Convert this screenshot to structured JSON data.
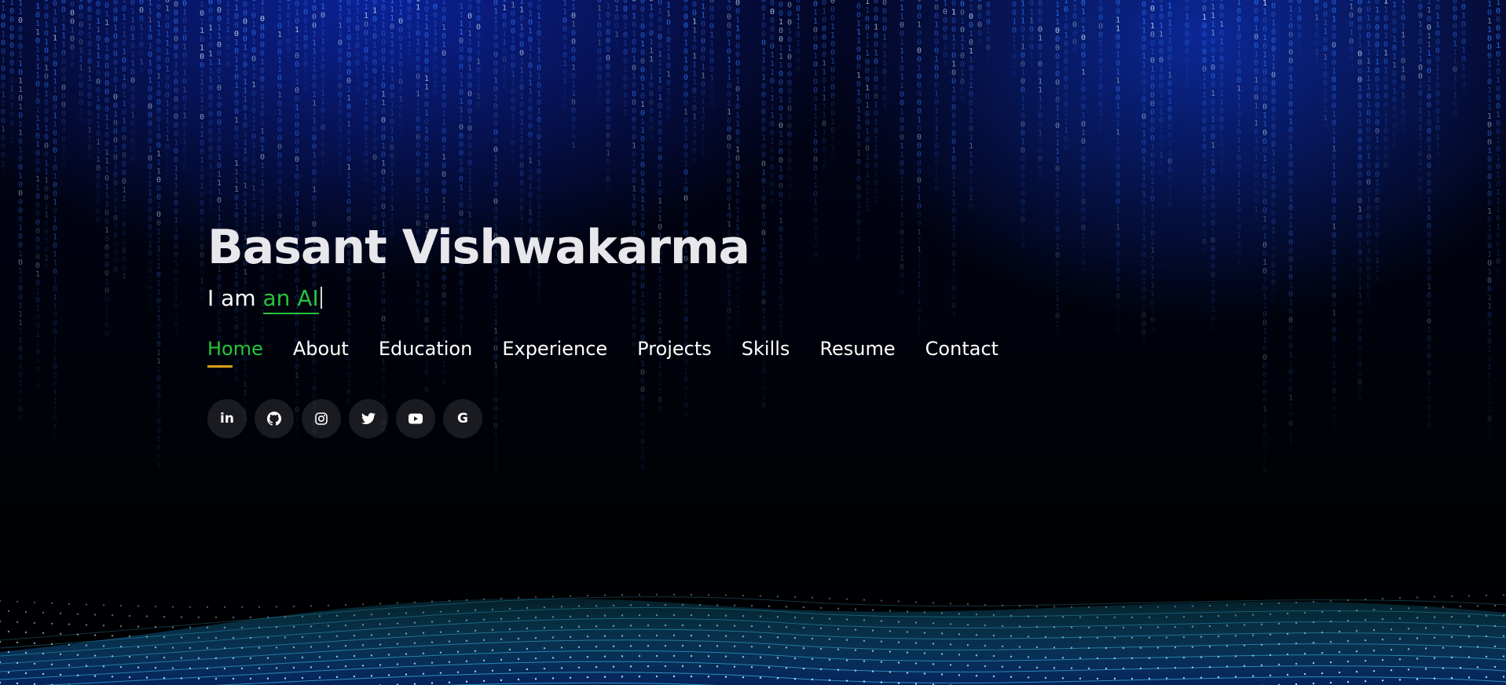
{
  "hero": {
    "name": "Basant Vishwakarma",
    "tagline_prefix": "I am",
    "typed_text": "an AI"
  },
  "nav": {
    "items": [
      {
        "label": "Home",
        "active": true
      },
      {
        "label": "About",
        "active": false
      },
      {
        "label": "Education",
        "active": false
      },
      {
        "label": "Experience",
        "active": false
      },
      {
        "label": "Projects",
        "active": false
      },
      {
        "label": "Skills",
        "active": false
      },
      {
        "label": "Resume",
        "active": false
      },
      {
        "label": "Contact",
        "active": false
      }
    ]
  },
  "socials": [
    {
      "icon": "linkedin-icon",
      "glyph": "in"
    },
    {
      "icon": "github-icon"
    },
    {
      "icon": "instagram-icon"
    },
    {
      "icon": "twitter-icon"
    },
    {
      "icon": "youtube-icon"
    },
    {
      "icon": "google-icon",
      "glyph": "G"
    }
  ],
  "colors": {
    "accent_green": "#26c43b",
    "active_underline": "#d8a21a",
    "text": "#ffffff",
    "rain_blue": "#3a8dff"
  }
}
